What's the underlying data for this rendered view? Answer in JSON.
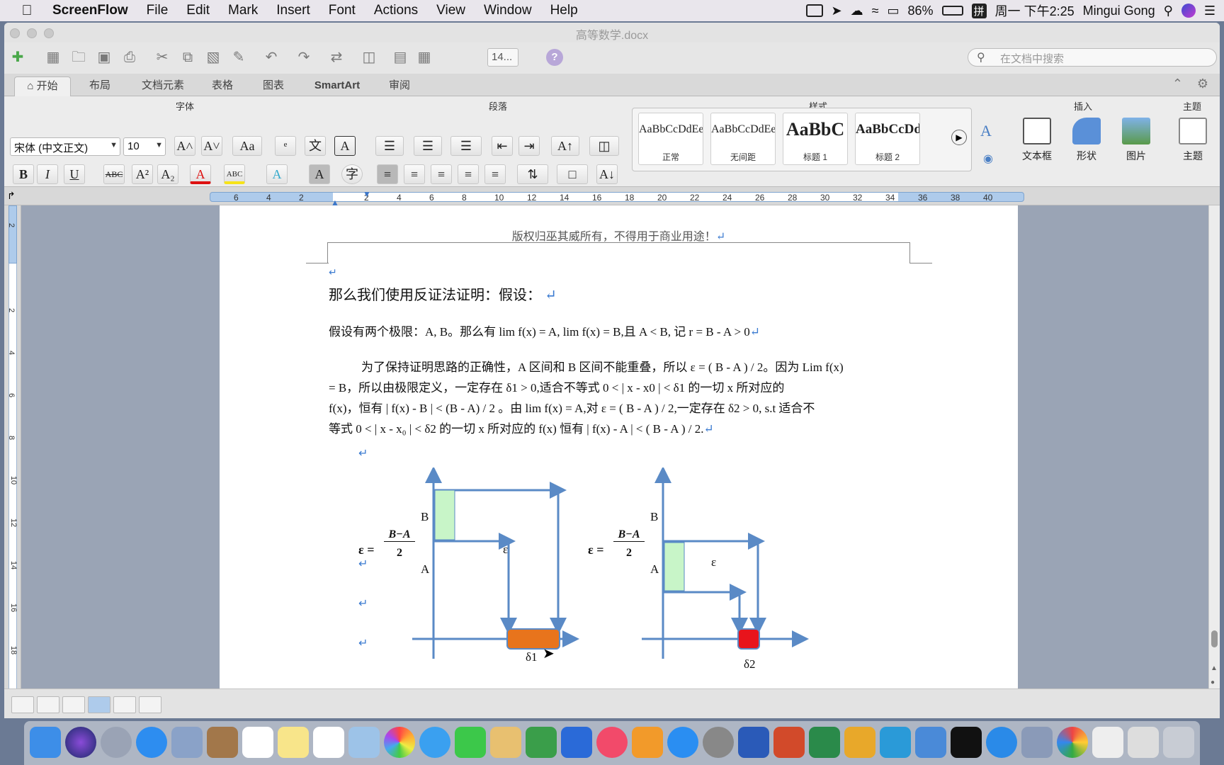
{
  "menubar": {
    "app": "ScreenFlow",
    "items": [
      "File",
      "Edit",
      "Mark",
      "Insert",
      "Font",
      "Actions",
      "View",
      "Window",
      "Help"
    ],
    "battery": "86%",
    "ime": "拼",
    "clock": "周一 下午2:25",
    "user": "Mingui Gong"
  },
  "window": {
    "title": "高等数学.docx"
  },
  "toolbar": {
    "font_size_box": "14...",
    "search_placeholder": "在文档中搜索"
  },
  "tabs": [
    "开始",
    "布局",
    "文档元素",
    "表格",
    "图表",
    "SmartArt",
    "审阅"
  ],
  "ribbon": {
    "group_font": "字体",
    "group_para": "段落",
    "group_styles": "样式",
    "group_insert": "插入",
    "group_theme": "主题",
    "font_name": "宋体 (中文正文)",
    "font_size": "10",
    "styles": [
      {
        "sample": "AaBbCcDdEe",
        "name": "正常"
      },
      {
        "sample": "AaBbCcDdEe",
        "name": "无间距"
      },
      {
        "sample": "AaBbC",
        "name": "标题 1"
      },
      {
        "sample": "AaBbCcDd",
        "name": "标题 2"
      }
    ],
    "insert_items": [
      "文本框",
      "形状",
      "图片"
    ],
    "theme_item": "主题",
    "glyphs": {
      "bold": "B",
      "italic": "I",
      "underline": "U",
      "strike": "ABC",
      "sup": "A²",
      "sub": "A₂",
      "wen": "文"
    }
  },
  "ruler": {
    "ticks": [
      "6",
      "4",
      "2",
      "",
      "2",
      "4",
      "6",
      "8",
      "10",
      "12",
      "14",
      "16",
      "18",
      "20",
      "22",
      "24",
      "26",
      "28",
      "30",
      "32",
      "34",
      "36",
      "38",
      "40"
    ]
  },
  "vruler": {
    "ticks": [
      "2",
      "",
      "2",
      "4",
      "6",
      "8",
      "10",
      "12",
      "14",
      "16",
      "18"
    ]
  },
  "doc": {
    "header": "版权归巫其威所有，不得用于商业用途！",
    "heading": "那么我们使用反证法证明：假设：",
    "para1": "假设有两个极限：A, B。那么有 lim f(x) = A, lim f(x) = B,且  A < B,  记  r = B - A > 0",
    "para2_lines": [
      "为了保持证明思路的正确性，A 区间和 B 区间不能重叠，所以 ε = ( B - A ) / 2。因为 Lim f(x)",
      "= B，所以由极限定义，一定存在  δ1 > 0,适合不等式  0 < | x - x0 | < δ1  的一切 x 所对应的",
      "f(x)，恒有  | f(x) - B | < (B - A) / 2  。由 lim f(x) = A,对  ε = ( B - A ) / 2,一定存在  δ2 > 0, s.t  适合不",
      "等式  0 < | x - x₀ | < δ2  的一切 x 所对应的  f(x)  恒有   | f(x) - A | < ( B - A ) / 2."
    ],
    "para_mark": "↵",
    "fig": {
      "eps_left": "ε =",
      "frac_num": "B−A",
      "frac_den": "2",
      "label_B": "B",
      "label_A": "A",
      "eps": "ε",
      "delta1": "δ1",
      "delta2": "δ2"
    }
  },
  "colors": {
    "accent": "#5a8ac6",
    "green": "#c8f5c8",
    "orange": "#e8741c",
    "red": "#e8141c"
  }
}
